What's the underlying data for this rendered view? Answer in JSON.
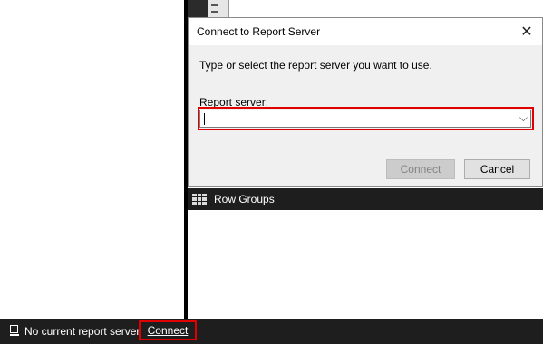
{
  "dialog": {
    "title": "Connect to Report Server",
    "instruction": "Type or select the report server you want to use.",
    "server_label": "Report server:",
    "server_value": "",
    "connect_label": "Connect",
    "cancel_label": "Cancel",
    "close_glyph": "✕",
    "dropdown_glyph": "⌵"
  },
  "panel": {
    "row_groups_label": "Row Groups"
  },
  "status_bar": {
    "status_text": "No current report server",
    "connect_link": "Connect"
  },
  "colors": {
    "highlight": "#e00000",
    "dark_bar": "#1e1e1e",
    "dialog_bg": "#f0f0f0"
  }
}
